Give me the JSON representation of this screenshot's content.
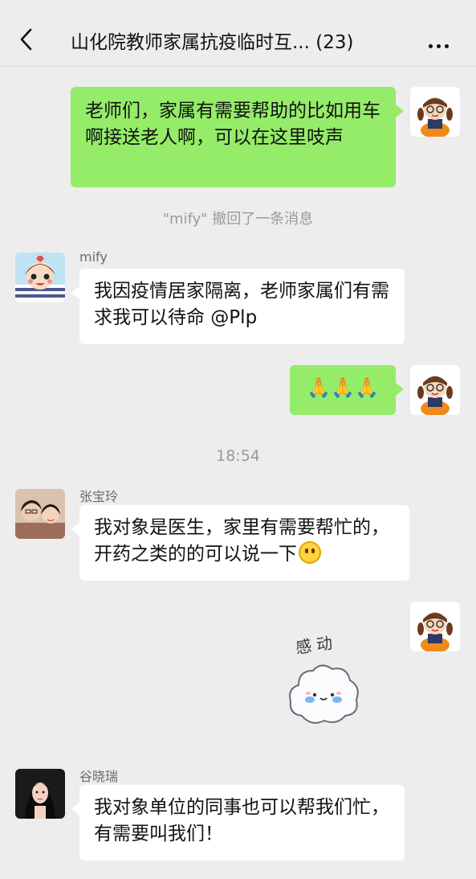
{
  "header": {
    "title": "山化院教师家属抗疫临时互...",
    "count": "(23)"
  },
  "messages": {
    "m1": {
      "text": "老师们，家属有需要帮助的比如用车啊接送老人啊，可以在这里吱声"
    },
    "recall": {
      "text": "\"mify\" 撤回了一条消息"
    },
    "m2": {
      "sender": "mify",
      "text": "我因疫情居家隔离，老师家属们有需求我可以待命 @Plp"
    },
    "m3": {
      "emoji": "🙏🙏🙏"
    },
    "time": {
      "text": "18:54"
    },
    "m4": {
      "sender": "张宝玲",
      "text": "我对象是医生，家里有需要帮忙的，开药之类的的可以说一下"
    },
    "m5": {
      "sticker_text": "感动"
    },
    "m6": {
      "sender": "谷晓瑞",
      "text": "我对象单位的同事也可以帮我们忙，有需要叫我们！"
    }
  }
}
